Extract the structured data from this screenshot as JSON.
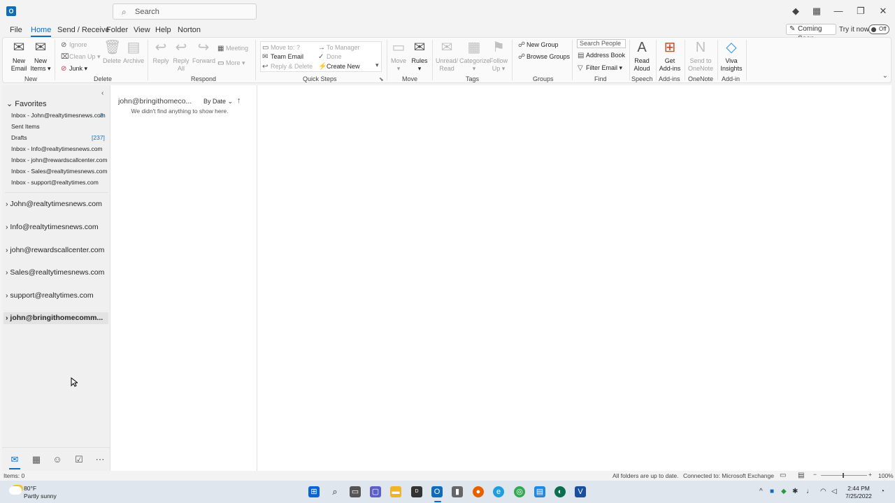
{
  "window": {
    "app_icon": "O",
    "search_placeholder": "Search",
    "controls": {
      "diamond": "◆",
      "apps": "▦",
      "minimize": "—",
      "restore": "❐",
      "close": "✕"
    }
  },
  "menu": {
    "tabs": [
      "File",
      "Home",
      "Send / Receive",
      "Folder",
      "View",
      "Help",
      "Norton"
    ],
    "active": "Home",
    "coming_soon": "Coming Soon",
    "try_it": "Try it now",
    "toggle": "Off"
  },
  "ribbon": {
    "groups": {
      "new": "New",
      "delete": "Delete",
      "respond": "Respond",
      "quick_steps": "Quick Steps",
      "move": "Move",
      "tags": "Tags",
      "groups": "Groups",
      "find": "Find",
      "speech": "Speech",
      "addins": "Add-ins",
      "onenote": "OneNote",
      "addin": "Add-in"
    },
    "new_email": [
      "New",
      "Email"
    ],
    "new_items": [
      "New",
      "Items"
    ],
    "ignore": "Ignore",
    "clean_up": "Clean Up",
    "junk": "Junk",
    "delete": "Delete",
    "archive": "Archive",
    "reply": "Reply",
    "reply_all": [
      "Reply",
      "All"
    ],
    "forward": "Forward",
    "meeting": "Meeting",
    "more": "More",
    "quick_steps": {
      "move_to": "Move to: ?",
      "team_email": "Team Email",
      "reply_delete": "Reply & Delete",
      "to_manager": "To Manager",
      "done": "Done",
      "create_new": "Create New"
    },
    "move": "Move",
    "rules": "Rules",
    "unread_read": [
      "Unread/",
      "Read"
    ],
    "categorize": "Categorize",
    "follow_up": [
      "Follow",
      "Up"
    ],
    "new_group": "New Group",
    "browse_groups": "Browse Groups",
    "search_people": "Search People",
    "address_book": "Address Book",
    "filter_email": "Filter Email",
    "read_aloud": [
      "Read",
      "Aloud"
    ],
    "get_addins": [
      "Get",
      "Add-ins"
    ],
    "send_onenote": [
      "Send to",
      "OneNote"
    ],
    "viva": [
      "Viva",
      "Insights"
    ]
  },
  "nav": {
    "favorites_label": "Favorites",
    "favorites": [
      {
        "label": "Inbox - John@realtytimesnews.com",
        "count": "3"
      },
      {
        "label": "Sent Items",
        "count": ""
      },
      {
        "label": "Drafts",
        "count": "[237]"
      },
      {
        "label": "Inbox - Info@realtytimesnews.com",
        "count": ""
      },
      {
        "label": "Inbox - john@rewardscallcenter.com",
        "count": ""
      },
      {
        "label": "Inbox - Sales@realtytimesnews.com",
        "count": ""
      },
      {
        "label": "Inbox - support@realtytimes.com",
        "count": ""
      }
    ],
    "accounts": [
      "John@realtytimesnews.com",
      "Info@realtytimesnews.com",
      "john@rewardscallcenter.com",
      "Sales@realtytimesnews.com",
      "support@realtytimes.com",
      "john@bringithomecomm..."
    ]
  },
  "list": {
    "folder": "john@bringithomeco...",
    "sort": "By Date",
    "empty": "We didn't find anything to show here."
  },
  "status": {
    "items": "Items: 0",
    "sync": "All folders are up to date.",
    "connection": "Connected to: Microsoft Exchange",
    "zoom": "100%"
  },
  "taskbar": {
    "temp": "80°F",
    "weather": "Partly sunny",
    "time": "2:44 PM",
    "date": "7/25/2022"
  }
}
